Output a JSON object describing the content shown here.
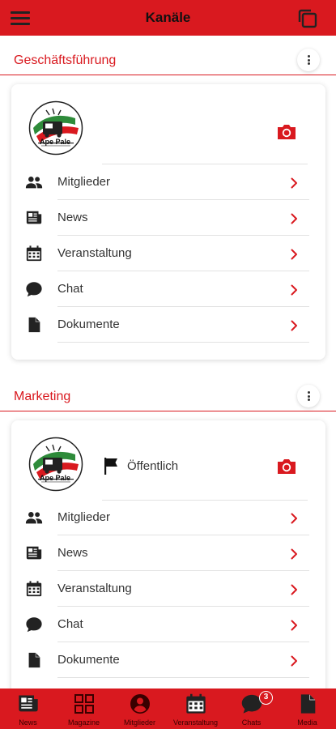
{
  "header": {
    "title": "Kanäle",
    "menu_icon": "hamburger-menu-icon",
    "action_icon": "copy-icon"
  },
  "colors": {
    "accent": "#d9191f",
    "text": "#333333"
  },
  "groups": [
    {
      "title": "Geschäftsführung",
      "logo_text": "Ape Pale",
      "visibility": null,
      "items": [
        {
          "label": "Mitglieder",
          "icon": "members-icon"
        },
        {
          "label": "News",
          "icon": "newspaper-icon"
        },
        {
          "label": "Veranstaltung",
          "icon": "calendar-icon"
        },
        {
          "label": "Chat",
          "icon": "chat-icon"
        },
        {
          "label": "Dokumente",
          "icon": "document-icon"
        }
      ]
    },
    {
      "title": "Marketing",
      "logo_text": "Ape Pale",
      "visibility": "Öffentlich",
      "items": [
        {
          "label": "Mitglieder",
          "icon": "members-icon"
        },
        {
          "label": "News",
          "icon": "newspaper-icon"
        },
        {
          "label": "Veranstaltung",
          "icon": "calendar-icon"
        },
        {
          "label": "Chat",
          "icon": "chat-icon"
        },
        {
          "label": "Dokumente",
          "icon": "document-icon"
        }
      ]
    }
  ],
  "bottom_nav": {
    "tabs": [
      {
        "label": "News",
        "icon": "newspaper-icon"
      },
      {
        "label": "Magazine",
        "icon": "grid-icon"
      },
      {
        "label": "Mitglieder",
        "icon": "person-icon"
      },
      {
        "label": "Veranstaltung",
        "icon": "calendar-icon"
      },
      {
        "label": "Chats",
        "icon": "chat-icon",
        "badge": "3"
      },
      {
        "label": "Media",
        "icon": "document-icon"
      }
    ]
  }
}
